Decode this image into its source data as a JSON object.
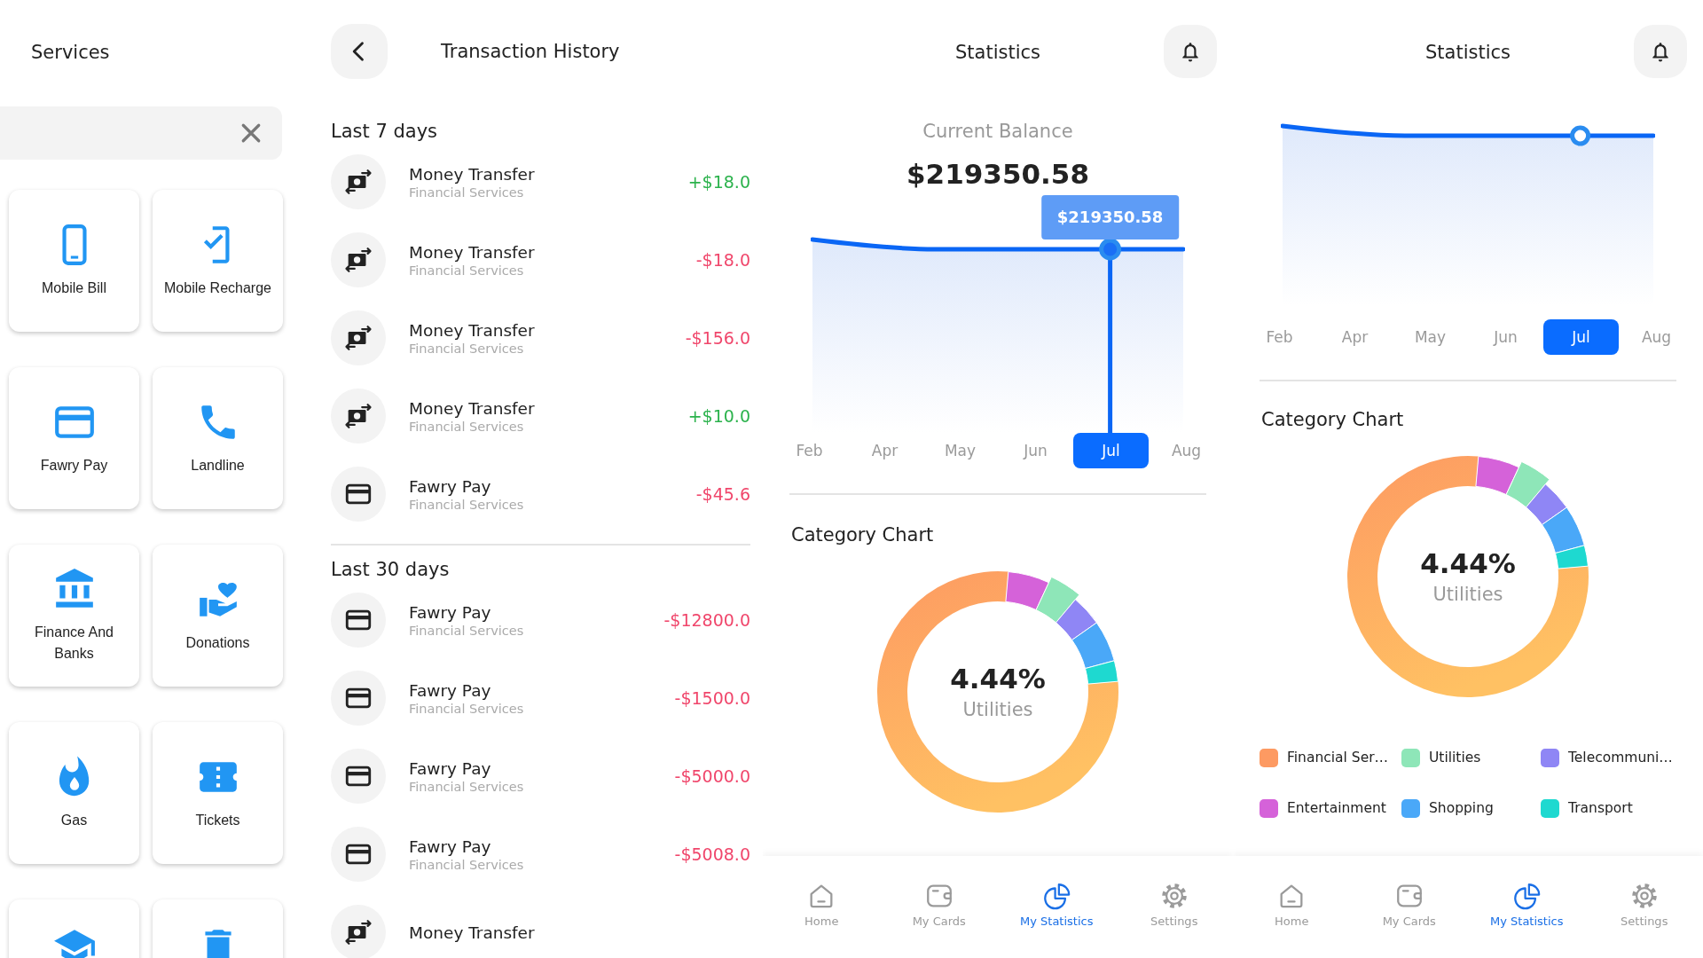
{
  "services": {
    "title": "Services",
    "items": [
      {
        "kind": "service",
        "label": "Mobile Bill"
      },
      {
        "kind": "service",
        "label": "Mobile Recharge"
      },
      {
        "kind": "service",
        "label": "Fawry Pay"
      },
      {
        "kind": "service",
        "label": "Landline"
      },
      {
        "kind": "service",
        "label": "Finance And Banks"
      },
      {
        "kind": "service",
        "label": "Donations"
      },
      {
        "kind": "service",
        "label": "Gas"
      },
      {
        "kind": "service",
        "label": "Tickets"
      },
      {
        "kind": "cut"
      },
      {
        "kind": "cut"
      }
    ]
  },
  "history": {
    "title": "Transaction History",
    "sections": [
      {
        "title": "Last 7 days",
        "items": [
          {
            "kind": "transfer",
            "title": "Money Transfer",
            "subtitle": "Financial Services",
            "amount": "+$18.0",
            "credit": true
          },
          {
            "kind": "transfer",
            "title": "Money Transfer",
            "subtitle": "Financial Services",
            "amount": "-$18.0",
            "credit": false
          },
          {
            "kind": "transfer",
            "title": "Money Transfer",
            "subtitle": "Financial Services",
            "amount": "-$156.0",
            "credit": false
          },
          {
            "kind": "transfer",
            "title": "Money Transfer",
            "subtitle": "Financial Services",
            "amount": "+$10.0",
            "credit": true
          },
          {
            "kind": "card",
            "title": "Fawry Pay",
            "subtitle": "Financial Services",
            "amount": "-$45.6",
            "credit": false
          }
        ]
      },
      {
        "title": "Last 30 days",
        "items": [
          {
            "kind": "card",
            "title": "Fawry Pay",
            "subtitle": "Financial Services",
            "amount": "-$12800.0",
            "credit": false
          },
          {
            "kind": "card",
            "title": "Fawry Pay",
            "subtitle": "Financial Services",
            "amount": "-$1500.0",
            "credit": false
          },
          {
            "kind": "card",
            "title": "Fawry Pay",
            "subtitle": "Financial Services",
            "amount": "-$5000.0",
            "credit": false
          },
          {
            "kind": "card",
            "title": "Fawry Pay",
            "subtitle": "Financial Services",
            "amount": "-$5008.0",
            "credit": false
          },
          {
            "kind": "transfer",
            "title": "Money Transfer"
          }
        ]
      }
    ]
  },
  "stats": [
    {
      "title": "Statistics",
      "balance_label": "Current Balance",
      "balance": "$219350.58",
      "tooltip": "$219350.58",
      "months": [
        {
          "label": "Feb",
          "selected": false
        },
        {
          "label": "Apr",
          "selected": false
        },
        {
          "label": "May",
          "selected": false
        },
        {
          "label": "Jun",
          "selected": false
        },
        {
          "label": "Jul",
          "selected": true
        },
        {
          "label": "Aug",
          "selected": false
        }
      ],
      "category_title": "Category Chart",
      "center_value": "4.44%",
      "center_label": "Utilities",
      "nav": [
        {
          "label": "Home",
          "selected": false
        },
        {
          "label": "My Cards",
          "selected": false
        },
        {
          "label": "My Statistics",
          "selected": true
        },
        {
          "label": "Settings",
          "selected": false
        }
      ]
    },
    {
      "title": "Statistics",
      "months": [
        {
          "label": "Feb",
          "selected": false
        },
        {
          "label": "Apr",
          "selected": false
        },
        {
          "label": "May",
          "selected": false
        },
        {
          "label": "Jun",
          "selected": false
        },
        {
          "label": "Jul",
          "selected": true
        },
        {
          "label": "Aug",
          "selected": false
        }
      ],
      "category_title": "Category Chart",
      "center_value": "4.44%",
      "center_label": "Utilities",
      "legend": [
        {
          "label": "Financial Ser…",
          "color": "#fd9a62"
        },
        {
          "label": "Utilities",
          "color": "#8ee6b8"
        },
        {
          "label": "Telecommuni…",
          "color": "#8f86f5"
        },
        {
          "label": "Entertainment",
          "color": "#d562d9"
        },
        {
          "label": "Shopping",
          "color": "#4aa8f8"
        },
        {
          "label": "Transport",
          "color": "#1ed9d0"
        }
      ],
      "nav": [
        {
          "label": "Home",
          "selected": false
        },
        {
          "label": "My Cards",
          "selected": false
        },
        {
          "label": "My Statistics",
          "selected": true
        },
        {
          "label": "Settings",
          "selected": false
        }
      ]
    }
  ]
}
